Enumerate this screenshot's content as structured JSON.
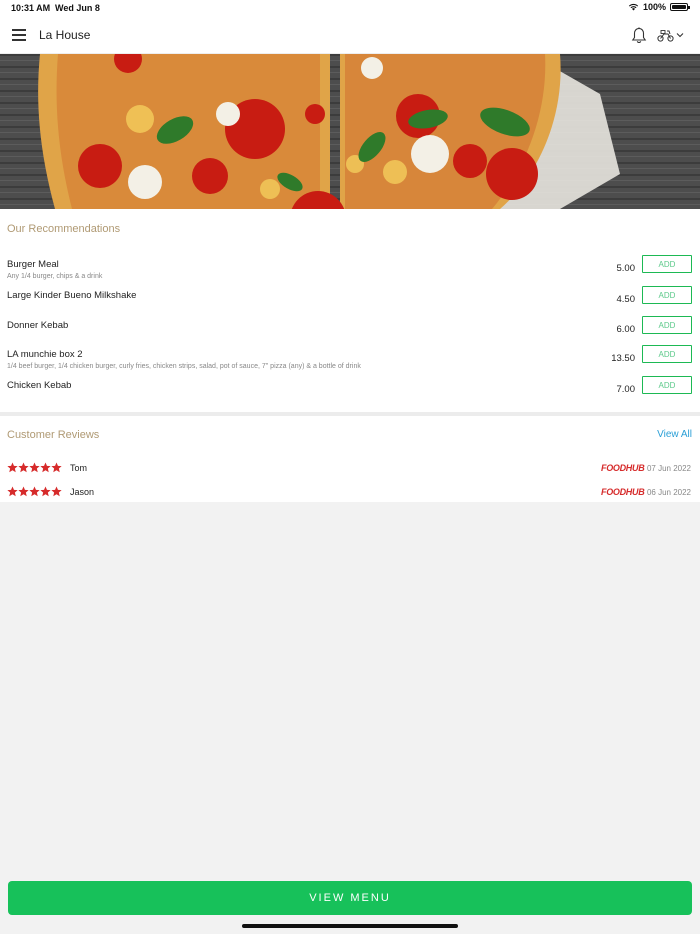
{
  "status_bar": {
    "time": "10:31 AM",
    "date": "Wed Jun 8",
    "battery": "100%"
  },
  "header": {
    "title": "La House",
    "icons": [
      "menu-icon",
      "bell-icon",
      "delivery-scooter-icon",
      "chevron-down-icon"
    ]
  },
  "recommendations": {
    "title": "Our Recommendations",
    "add_label": "ADD",
    "items": [
      {
        "name": "Burger Meal",
        "desc": "Any 1/4 burger, chips & a drink",
        "price": "5.00"
      },
      {
        "name": "Large Kinder Bueno Milkshake",
        "desc": "",
        "price": "4.50"
      },
      {
        "name": "Donner Kebab",
        "desc": "",
        "price": "6.00"
      },
      {
        "name": "LA munchie box 2",
        "desc": "1/4 beef burger, 1/4 chicken burger, curly fries, chicken strips, salad, pot of sauce, 7\" pizza (any) & a bottle of drink",
        "price": "13.50"
      },
      {
        "name": "Chicken Kebab",
        "desc": "",
        "price": "7.00"
      }
    ]
  },
  "reviews": {
    "title": "Customer Reviews",
    "view_all": "View All",
    "items": [
      {
        "name": "Tom",
        "rating": 5,
        "source": "FOODHUB",
        "date": "07 Jun 2022"
      },
      {
        "name": "Jason",
        "rating": 5,
        "source": "FOODHUB",
        "date": "06 Jun 2022"
      }
    ]
  },
  "footer": {
    "view_menu": "VIEW MENU"
  },
  "colors": {
    "accent": "#17c15a",
    "section_title": "#b09a74",
    "link": "#2a9fd6",
    "star": "#d62b2b"
  }
}
